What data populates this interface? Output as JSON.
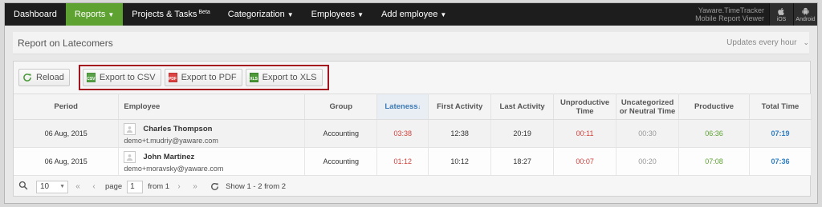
{
  "nav": {
    "items": [
      {
        "label": "Dashboard"
      },
      {
        "label": "Reports"
      },
      {
        "label": "Projects & Tasks",
        "sup": "Beta"
      },
      {
        "label": "Categorization"
      },
      {
        "label": "Employees"
      },
      {
        "label": "Add employee"
      }
    ],
    "brand_line1": "Yaware.TimeTracker",
    "brand_line2": "Mobile Report Viewer",
    "ios_label": "iOS",
    "android_label": "Android"
  },
  "header": {
    "title": "Report on Latecomers",
    "updates": "Updates every hour"
  },
  "toolbar": {
    "reload": "Reload",
    "export_csv": "Export to CSV",
    "export_pdf": "Export to PDF",
    "export_xls": "Export to XLS"
  },
  "table": {
    "columns": [
      "Period",
      "Employee",
      "Group",
      "Lateness",
      "First Activity",
      "Last Activity",
      "Unproductive Time",
      "Uncategorized or Neutral Time",
      "Productive",
      "Total Time"
    ],
    "rows": [
      {
        "period": "06 Aug, 2015",
        "name": "Charles Thompson",
        "email": "demo+t.mudriy@yaware.com",
        "group": "Accounting",
        "lateness": "03:38",
        "first": "12:38",
        "last": "20:19",
        "unproductive": "00:11",
        "neutral": "00:30",
        "productive": "06:36",
        "total": "07:19"
      },
      {
        "period": "06 Aug, 2015",
        "name": "John Martinez",
        "email": "demo+moravsky@yaware.com",
        "group": "Accounting",
        "lateness": "01:12",
        "first": "10:12",
        "last": "18:27",
        "unproductive": "00:07",
        "neutral": "00:20",
        "productive": "07:08",
        "total": "07:36"
      }
    ]
  },
  "pager": {
    "page_size": "10",
    "page_label": "page",
    "page_value": "1",
    "from_label": "from 1",
    "status": "Show 1 - 2 from 2"
  },
  "colors": {
    "nav_active": "#5ea331",
    "export_highlight": "#a3141f",
    "late": "#d0423d",
    "productive": "#5da233",
    "total": "#2f7ec2"
  }
}
